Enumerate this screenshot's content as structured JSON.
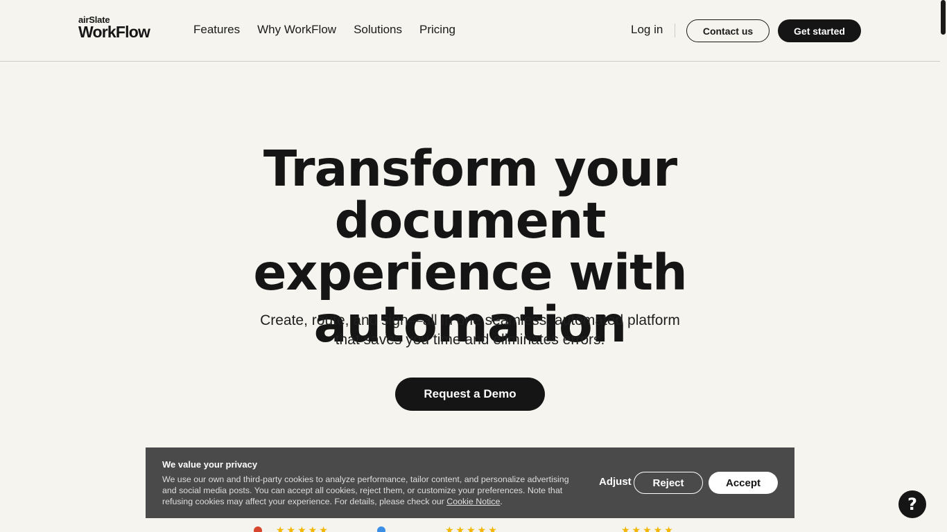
{
  "header": {
    "logo_small": "airSlate",
    "logo_big": "WorkFlow",
    "nav": [
      "Features",
      "Why WorkFlow",
      "Solutions",
      "Pricing"
    ],
    "login": "Log in",
    "contact": "Contact us",
    "get_started": "Get started"
  },
  "hero": {
    "title_lines": [
      "Transform your document",
      "experience with",
      "automation"
    ],
    "subtitle_lines": [
      "Create, route, and sign—all in one seamless, automated platform",
      "that saves you time and eliminates errors."
    ],
    "cta": "Request a Demo"
  },
  "ratings": [
    "★★★★★",
    "★★★★★",
    "★★★★★"
  ],
  "cookie": {
    "title": "We value your privacy",
    "text": "We use our own and third-party cookies to analyze performance, tailor content, and personalize advertising and social media posts. You can accept all cookies, reject them, or customize your preferences. Note that refusing cookies may affect your experience. For details, please check our ",
    "link": "Cookie Notice",
    "after": ".",
    "adjust": "Adjust",
    "reject": "Reject",
    "accept": "Accept"
  },
  "help": {
    "label": "?",
    "icon": "question-icon"
  },
  "colors": {
    "background": "#f5f4ef",
    "primary": "#151515",
    "banner": "#4a4a4a",
    "stars": "#f2b600"
  }
}
